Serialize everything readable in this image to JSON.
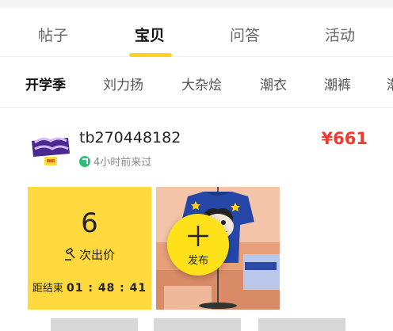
{
  "tabs": [
    {
      "label": "帖子"
    },
    {
      "label": "宝贝"
    },
    {
      "label": "问答"
    },
    {
      "label": "活动"
    }
  ],
  "active_tab": "宝贝",
  "categories": [
    {
      "label": "开学季"
    },
    {
      "label": "刘力扬"
    },
    {
      "label": "大杂烩"
    },
    {
      "label": "潮衣"
    },
    {
      "label": "潮裤"
    },
    {
      "label": "潮"
    }
  ],
  "item": {
    "username": "tb270448182",
    "last_seen": "4小时前来过",
    "price": "¥661",
    "bid_count": "6",
    "bid_label": "次出价",
    "countdown_label": "距结束",
    "countdown_time": "01 : 48 : 41"
  },
  "fab": {
    "label": "发布"
  },
  "colors": {
    "accent": "#ffd21f",
    "price": "#ef3b2f",
    "online": "#2cc17b"
  }
}
